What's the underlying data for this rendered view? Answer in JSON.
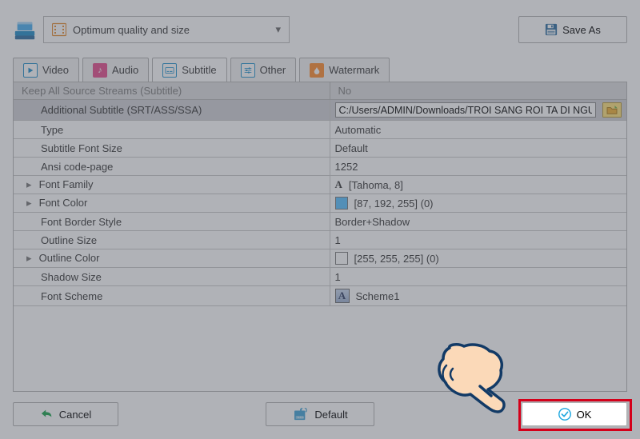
{
  "toolbar": {
    "preset_label": "Optimum quality and size",
    "save_as_label": "Save As"
  },
  "tabs": {
    "video": "Video",
    "audio": "Audio",
    "subtitle": "Subtitle",
    "other": "Other",
    "watermark": "Watermark"
  },
  "grid": {
    "header_left": "Keep All Source Streams (Subtitle)",
    "header_right": "No",
    "rows": [
      {
        "label": "Additional Subtitle (SRT/ASS/SSA)",
        "value": "C:/Users/ADMIN/Downloads/TROI SANG ROI TA DI NGU THOI.srt",
        "type": "path",
        "selected": true
      },
      {
        "label": "Type",
        "value": "Automatic"
      },
      {
        "label": "Subtitle Font Size",
        "value": "Default"
      },
      {
        "label": "Ansi code-page",
        "value": "1252"
      },
      {
        "label": "Font Family",
        "value": "[Tahoma, 8]",
        "type": "font",
        "expand": true
      },
      {
        "label": "Font Color",
        "value": "[87, 192, 255] (0)",
        "type": "color",
        "swatch": "#57c0ff",
        "expand": true
      },
      {
        "label": "Font Border Style",
        "value": "Border+Shadow"
      },
      {
        "label": "Outline Size",
        "value": "1"
      },
      {
        "label": "Outline Color",
        "value": "[255, 255, 255] (0)",
        "type": "color",
        "swatch": "#ffffff",
        "expand": true
      },
      {
        "label": "Shadow Size",
        "value": "1"
      },
      {
        "label": "Font Scheme",
        "value": "Scheme1",
        "type": "scheme"
      }
    ]
  },
  "buttons": {
    "cancel": "Cancel",
    "default": "Default",
    "ok": "OK"
  },
  "colors": {
    "accent": "#1e8cc9",
    "ok_check": "#1ea7df"
  }
}
